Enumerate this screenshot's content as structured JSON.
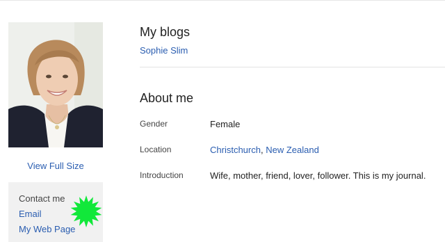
{
  "profile": {
    "view_full_size": "View Full Size"
  },
  "contact": {
    "title": "Contact me",
    "email": "Email",
    "web_page": "My Web Page",
    "starburst_color": "#11e83a"
  },
  "blogs": {
    "title": "My blogs",
    "items": [
      {
        "name": "Sophie Slim"
      }
    ]
  },
  "about": {
    "title": "About me",
    "gender": {
      "label": "Gender",
      "value": "Female"
    },
    "location": {
      "label": "Location",
      "city": "Christchurch",
      "separator": ",",
      "country": "New Zealand"
    },
    "introduction": {
      "label": "Introduction",
      "value": "Wife, mother, friend, lover, follower. This is my journal."
    }
  },
  "colors": {
    "link": "#2a5db0",
    "contact_background": "#f1f1f1"
  }
}
